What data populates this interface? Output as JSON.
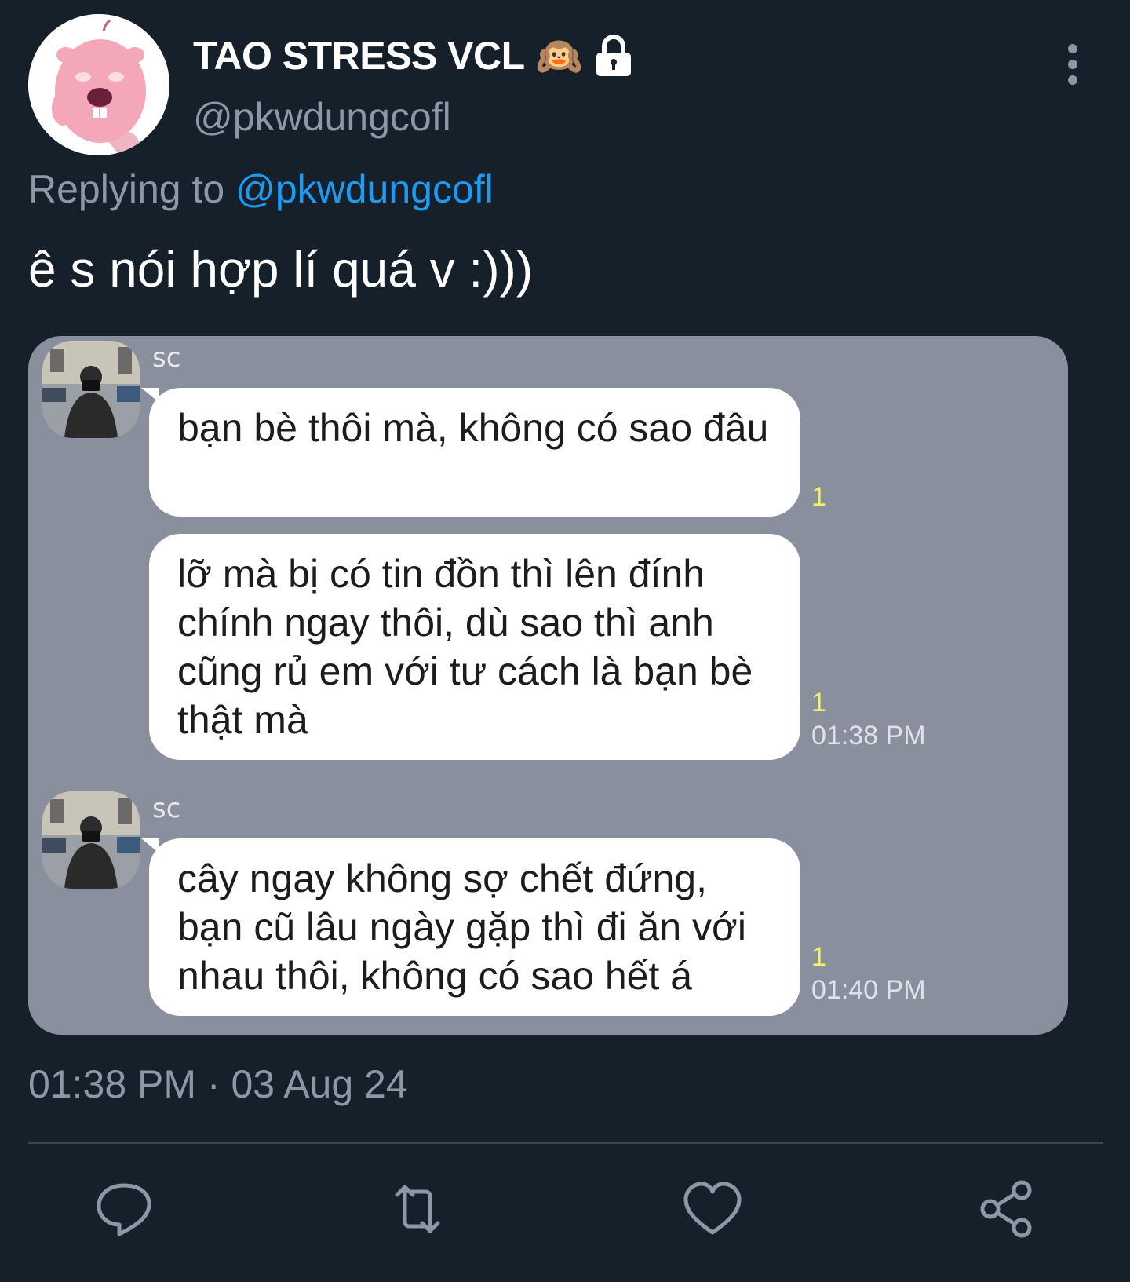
{
  "tweet": {
    "display_name": "TAO STRESS VCL",
    "name_emoji": "🙉",
    "handle": "@pkwdungcofl",
    "reply_prefix": "Replying to",
    "reply_mention": "@pkwdungcofl",
    "text": "ê s nói hợp lí quá v :)))",
    "timestamp": "01:38 PM · 03 Aug 24"
  },
  "chat": {
    "groups": [
      {
        "sender": "sc",
        "messages": [
          {
            "text": "bạn bè thôi mà, không có sao đâu",
            "read": "1",
            "time": ""
          },
          {
            "text": "lỡ mà bị có tin đồn thì lên đính chính ngay thôi, dù sao thì anh cũng rủ em với tư cách là bạn bè thật mà",
            "read": "1",
            "time": "01:38 PM"
          }
        ]
      },
      {
        "sender": "sc",
        "messages": [
          {
            "text": "cây ngay không sợ chết đứng, bạn cũ lâu ngày gặp thì đi ăn với nhau thôi, không có sao hết á",
            "read": "1",
            "time": "01:40 PM"
          }
        ]
      }
    ]
  },
  "icons": {
    "more": "more-vertical-icon",
    "lock": "lock-icon",
    "reply": "reply-bubble-icon",
    "retweet": "retweet-icon",
    "like": "heart-icon",
    "share": "share-icon"
  },
  "colors": {
    "background": "#15202b",
    "secondary_text": "#8b98a5",
    "mention": "#1d9bf0",
    "chat_background": "#8a8f9e",
    "read_count": "#f4f06a"
  }
}
